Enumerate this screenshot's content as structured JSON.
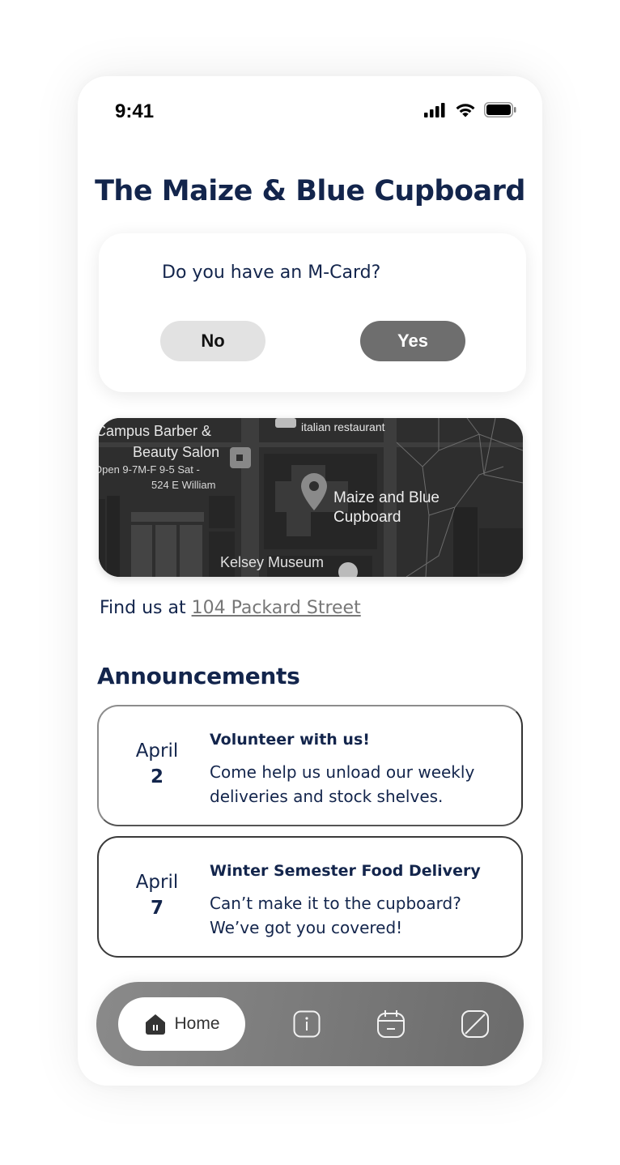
{
  "status_bar": {
    "time": "9:41",
    "icons": [
      "cellular-signal-icon",
      "wifi-icon",
      "battery-icon"
    ]
  },
  "app_title": "The Maize & Blue Cupboard",
  "mcard_prompt": {
    "question": "Do you have an M-Card?",
    "no_label": "No",
    "yes_label": "Yes"
  },
  "map": {
    "labels": {
      "barber_line1": "Campus Barber &",
      "barber_line2": "Beauty Salon",
      "barber_hours": "Open 9-7M-F 9-5 Sat -",
      "barber_address": "524 E William",
      "restaurant": "italian restaurant",
      "pin_line1": "Maize and Blue",
      "pin_line2": "Cupboard",
      "museum": "Kelsey Museum"
    }
  },
  "location": {
    "prefix": "Find us at ",
    "address_link": "104 Packard Street"
  },
  "announcements": {
    "heading": "Announcements",
    "items": [
      {
        "month": "April",
        "day": "2",
        "title": "Volunteer with us!",
        "body": "Come help us unload our weekly deliveries and stock shelves."
      },
      {
        "month": "April",
        "day": "7",
        "title": "Winter Semester Food Delivery",
        "body": "Can’t make it to the cupboard? We’ve got you covered!"
      }
    ]
  },
  "bottom_nav": {
    "active_label": "Home",
    "items": [
      "home-icon",
      "info-icon",
      "calendar-icon",
      "slash-square-icon"
    ]
  },
  "colors": {
    "navy": "#13254c",
    "gray_button": "#6e6e6e",
    "light_button": "#e2e2e2"
  }
}
